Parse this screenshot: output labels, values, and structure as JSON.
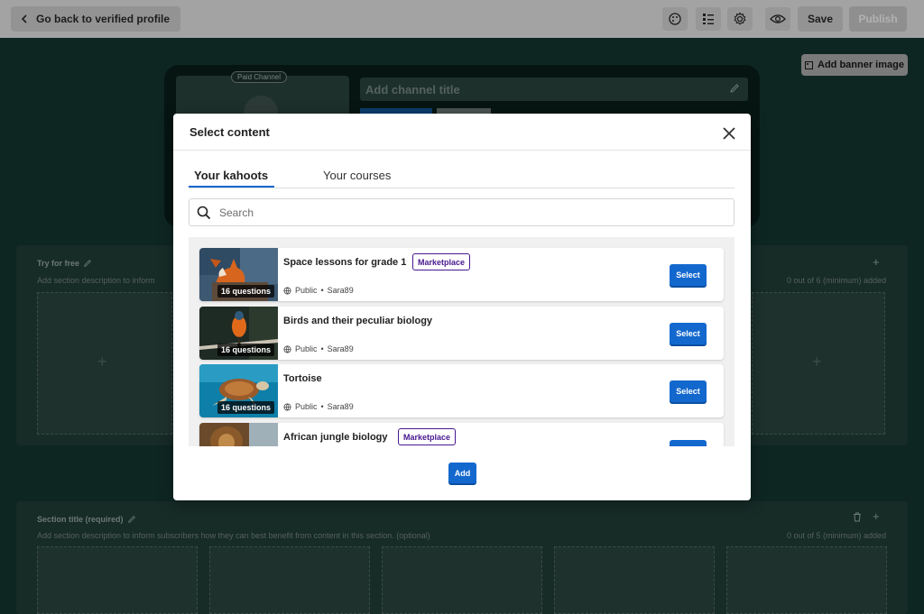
{
  "topbar": {
    "back_label": "Go back to verified profile",
    "icons": [
      "palette-icon",
      "list-icon",
      "gear-icon",
      "eye-icon"
    ],
    "save_label": "Save",
    "publish_label": "Publish"
  },
  "channel": {
    "banner_button_label": "Add banner image",
    "paid_badge": "Paid Channel",
    "title_placeholder": "Add channel title"
  },
  "sections": [
    {
      "title": "Try for free",
      "description": "Add section description to inform",
      "count_text": "0 out of 6 (minimum) added"
    },
    {
      "title": "Section title (required)",
      "description": "Add section description to inform subscribers how they can best benefit from content in this section. (optional)",
      "count_text": "0 out of 5 (minimum) added"
    }
  ],
  "modal": {
    "title": "Select content",
    "tabs": [
      {
        "label": "Your kahoots",
        "active": true
      },
      {
        "label": "Your courses",
        "active": false
      }
    ],
    "search_placeholder": "Search",
    "items": [
      {
        "title": "Space lessons for grade 1",
        "badge": "Marketplace",
        "questions": "16 questions",
        "visibility": "Public",
        "author": "Sara89",
        "select_label": "Select"
      },
      {
        "title": "Birds and their peculiar biology",
        "badge": "",
        "questions": "16 questions",
        "visibility": "Public",
        "author": "Sara89",
        "select_label": "Select"
      },
      {
        "title": "Tortoise",
        "badge": "",
        "questions": "16 questions",
        "visibility": "Public",
        "author": "Sara89",
        "select_label": "Select"
      },
      {
        "title": "African jungle biology",
        "badge": "Marketplace",
        "questions": "",
        "visibility": "",
        "author": "",
        "select_label": ""
      }
    ],
    "add_label": "Add"
  },
  "colors": {
    "accent": "#1368ce",
    "marketplace": "#46178f",
    "overlay_bg": "#0e2622"
  }
}
